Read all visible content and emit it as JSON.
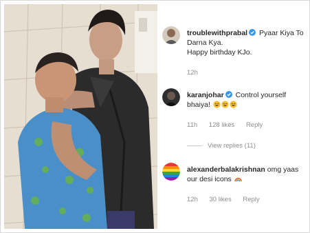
{
  "comments": [
    {
      "username": "troublewithprabal",
      "text_line1": "Pyaar Kiya To",
      "text_line2": "Darna Kya.",
      "text_line3": "Happy birthday KJo.",
      "time": "12h"
    },
    {
      "username": "karanjohar",
      "text_line1": "Control yourself",
      "text_line2": "bhaiya!",
      "time": "11h",
      "likes": "128 likes",
      "reply": "Reply",
      "view_replies": "View replies (11)"
    },
    {
      "username": "alexanderbalakrishnan",
      "text_line1": "omg yaas",
      "text_line2": "our desi icons",
      "time": "12h",
      "likes": "30 likes",
      "reply": "Reply"
    }
  ],
  "colors": {
    "verified_blue": "#3897f0",
    "meta_gray": "#8e8e8e",
    "text": "#262626"
  },
  "icons": [
    "verified-badge-icon",
    "laughing-emoji-icon",
    "rainbow-emoji-icon"
  ]
}
